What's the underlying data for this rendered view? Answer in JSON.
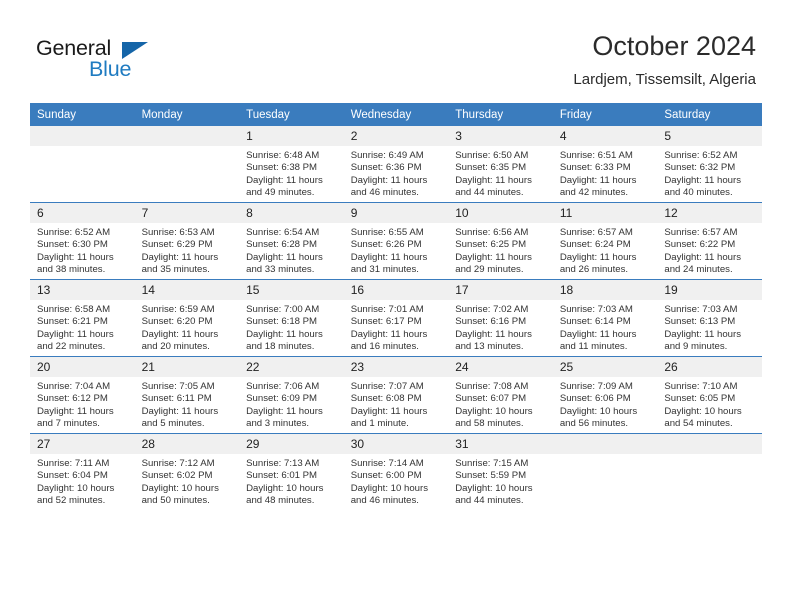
{
  "brand": {
    "name_line1": "General",
    "name_line2": "Blue",
    "logo_icon": "triangle-flag-icon",
    "accent_color": "#1f7bc1",
    "header_color": "#3a7cbe"
  },
  "header": {
    "title": "October 2024",
    "subtitle": "Lardjem, Tissemsilt, Algeria"
  },
  "calendar": {
    "weekday_headers": [
      "Sunday",
      "Monday",
      "Tuesday",
      "Wednesday",
      "Thursday",
      "Friday",
      "Saturday"
    ],
    "weeks": [
      [
        {
          "day": "",
          "lines": []
        },
        {
          "day": "",
          "lines": []
        },
        {
          "day": "1",
          "lines": [
            "Sunrise: 6:48 AM",
            "Sunset: 6:38 PM",
            "Daylight: 11 hours",
            "and 49 minutes."
          ]
        },
        {
          "day": "2",
          "lines": [
            "Sunrise: 6:49 AM",
            "Sunset: 6:36 PM",
            "Daylight: 11 hours",
            "and 46 minutes."
          ]
        },
        {
          "day": "3",
          "lines": [
            "Sunrise: 6:50 AM",
            "Sunset: 6:35 PM",
            "Daylight: 11 hours",
            "and 44 minutes."
          ]
        },
        {
          "day": "4",
          "lines": [
            "Sunrise: 6:51 AM",
            "Sunset: 6:33 PM",
            "Daylight: 11 hours",
            "and 42 minutes."
          ]
        },
        {
          "day": "5",
          "lines": [
            "Sunrise: 6:52 AM",
            "Sunset: 6:32 PM",
            "Daylight: 11 hours",
            "and 40 minutes."
          ]
        }
      ],
      [
        {
          "day": "6",
          "lines": [
            "Sunrise: 6:52 AM",
            "Sunset: 6:30 PM",
            "Daylight: 11 hours",
            "and 38 minutes."
          ]
        },
        {
          "day": "7",
          "lines": [
            "Sunrise: 6:53 AM",
            "Sunset: 6:29 PM",
            "Daylight: 11 hours",
            "and 35 minutes."
          ]
        },
        {
          "day": "8",
          "lines": [
            "Sunrise: 6:54 AM",
            "Sunset: 6:28 PM",
            "Daylight: 11 hours",
            "and 33 minutes."
          ]
        },
        {
          "day": "9",
          "lines": [
            "Sunrise: 6:55 AM",
            "Sunset: 6:26 PM",
            "Daylight: 11 hours",
            "and 31 minutes."
          ]
        },
        {
          "day": "10",
          "lines": [
            "Sunrise: 6:56 AM",
            "Sunset: 6:25 PM",
            "Daylight: 11 hours",
            "and 29 minutes."
          ]
        },
        {
          "day": "11",
          "lines": [
            "Sunrise: 6:57 AM",
            "Sunset: 6:24 PM",
            "Daylight: 11 hours",
            "and 26 minutes."
          ]
        },
        {
          "day": "12",
          "lines": [
            "Sunrise: 6:57 AM",
            "Sunset: 6:22 PM",
            "Daylight: 11 hours",
            "and 24 minutes."
          ]
        }
      ],
      [
        {
          "day": "13",
          "lines": [
            "Sunrise: 6:58 AM",
            "Sunset: 6:21 PM",
            "Daylight: 11 hours",
            "and 22 minutes."
          ]
        },
        {
          "day": "14",
          "lines": [
            "Sunrise: 6:59 AM",
            "Sunset: 6:20 PM",
            "Daylight: 11 hours",
            "and 20 minutes."
          ]
        },
        {
          "day": "15",
          "lines": [
            "Sunrise: 7:00 AM",
            "Sunset: 6:18 PM",
            "Daylight: 11 hours",
            "and 18 minutes."
          ]
        },
        {
          "day": "16",
          "lines": [
            "Sunrise: 7:01 AM",
            "Sunset: 6:17 PM",
            "Daylight: 11 hours",
            "and 16 minutes."
          ]
        },
        {
          "day": "17",
          "lines": [
            "Sunrise: 7:02 AM",
            "Sunset: 6:16 PM",
            "Daylight: 11 hours",
            "and 13 minutes."
          ]
        },
        {
          "day": "18",
          "lines": [
            "Sunrise: 7:03 AM",
            "Sunset: 6:14 PM",
            "Daylight: 11 hours",
            "and 11 minutes."
          ]
        },
        {
          "day": "19",
          "lines": [
            "Sunrise: 7:03 AM",
            "Sunset: 6:13 PM",
            "Daylight: 11 hours",
            "and 9 minutes."
          ]
        }
      ],
      [
        {
          "day": "20",
          "lines": [
            "Sunrise: 7:04 AM",
            "Sunset: 6:12 PM",
            "Daylight: 11 hours",
            "and 7 minutes."
          ]
        },
        {
          "day": "21",
          "lines": [
            "Sunrise: 7:05 AM",
            "Sunset: 6:11 PM",
            "Daylight: 11 hours",
            "and 5 minutes."
          ]
        },
        {
          "day": "22",
          "lines": [
            "Sunrise: 7:06 AM",
            "Sunset: 6:09 PM",
            "Daylight: 11 hours",
            "and 3 minutes."
          ]
        },
        {
          "day": "23",
          "lines": [
            "Sunrise: 7:07 AM",
            "Sunset: 6:08 PM",
            "Daylight: 11 hours",
            "and 1 minute."
          ]
        },
        {
          "day": "24",
          "lines": [
            "Sunrise: 7:08 AM",
            "Sunset: 6:07 PM",
            "Daylight: 10 hours",
            "and 58 minutes."
          ]
        },
        {
          "day": "25",
          "lines": [
            "Sunrise: 7:09 AM",
            "Sunset: 6:06 PM",
            "Daylight: 10 hours",
            "and 56 minutes."
          ]
        },
        {
          "day": "26",
          "lines": [
            "Sunrise: 7:10 AM",
            "Sunset: 6:05 PM",
            "Daylight: 10 hours",
            "and 54 minutes."
          ]
        }
      ],
      [
        {
          "day": "27",
          "lines": [
            "Sunrise: 7:11 AM",
            "Sunset: 6:04 PM",
            "Daylight: 10 hours",
            "and 52 minutes."
          ]
        },
        {
          "day": "28",
          "lines": [
            "Sunrise: 7:12 AM",
            "Sunset: 6:02 PM",
            "Daylight: 10 hours",
            "and 50 minutes."
          ]
        },
        {
          "day": "29",
          "lines": [
            "Sunrise: 7:13 AM",
            "Sunset: 6:01 PM",
            "Daylight: 10 hours",
            "and 48 minutes."
          ]
        },
        {
          "day": "30",
          "lines": [
            "Sunrise: 7:14 AM",
            "Sunset: 6:00 PM",
            "Daylight: 10 hours",
            "and 46 minutes."
          ]
        },
        {
          "day": "31",
          "lines": [
            "Sunrise: 7:15 AM",
            "Sunset: 5:59 PM",
            "Daylight: 10 hours",
            "and 44 minutes."
          ]
        },
        {
          "day": "",
          "lines": []
        },
        {
          "day": "",
          "lines": []
        }
      ]
    ]
  }
}
